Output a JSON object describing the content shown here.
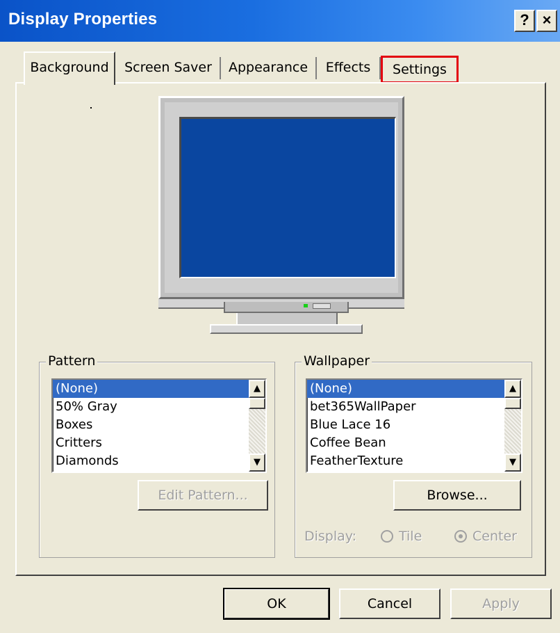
{
  "window": {
    "title": "Display Properties",
    "help_label": "?",
    "close_label": "×"
  },
  "tabs": [
    {
      "label": "Background",
      "active": true
    },
    {
      "label": "Screen Saver",
      "active": false
    },
    {
      "label": "Appearance",
      "active": false
    },
    {
      "label": "Effects",
      "active": false
    },
    {
      "label": "Settings",
      "active": false,
      "highlighted": true
    }
  ],
  "pattern": {
    "group_label": "Pattern",
    "items": [
      "(None)",
      "50% Gray",
      "Boxes",
      "Critters",
      "Diamonds"
    ],
    "selected": "(None)",
    "edit_button": "Edit Pattern..."
  },
  "wallpaper": {
    "group_label": "Wallpaper",
    "items": [
      "(None)",
      "bet365WallPaper",
      "Blue Lace 16",
      "Coffee Bean",
      "FeatherTexture"
    ],
    "selected": "(None)",
    "browse_button": "Browse...",
    "display_label": "Display:",
    "options": [
      {
        "label": "Tile",
        "selected": false
      },
      {
        "label": "Center",
        "selected": true
      }
    ]
  },
  "footer": {
    "ok": "OK",
    "cancel": "Cancel",
    "apply": "Apply"
  },
  "colors": {
    "titlebar": "#0a53c8",
    "selection": "#316ac5",
    "highlight_box": "#e3000f",
    "monitor_screen": "#0a46a0"
  },
  "icons": {
    "scroll_up": "scroll-up-arrow-icon",
    "scroll_down": "scroll-down-arrow-icon",
    "monitor": "monitor-preview-icon"
  }
}
